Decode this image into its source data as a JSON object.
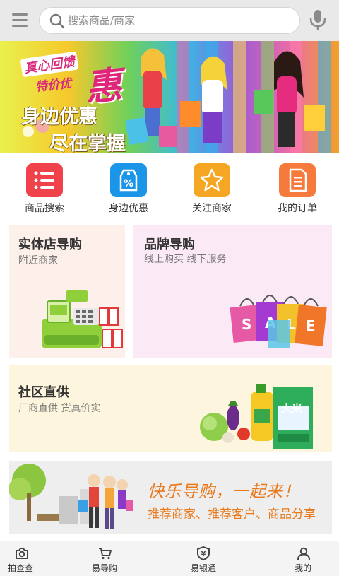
{
  "header": {
    "search_placeholder": "搜索商品/商家",
    "menu_icon": "menu-icon",
    "mic_icon": "microphone-icon"
  },
  "banner": {
    "slogan_line1": "真心回馈",
    "slogan_line2": "特价优",
    "slogan_big": "惠",
    "headline_1": "身边优惠",
    "headline_2": "尽在掌握"
  },
  "quick_actions": [
    {
      "label": "商品搜索",
      "icon": "list-icon",
      "color": "#f0424a"
    },
    {
      "label": "身边优惠",
      "icon": "discount-tag-icon",
      "color": "#1a95e8"
    },
    {
      "label": "关注商家",
      "icon": "star-icon",
      "color": "#f5a623"
    },
    {
      "label": "我的订单",
      "icon": "order-document-icon",
      "color": "#f57a3b"
    }
  ],
  "cards": {
    "store": {
      "title": "实体店导购",
      "subtitle": "附近商家",
      "bg": "#fdf0ea"
    },
    "brand": {
      "title": "品牌导购",
      "subtitle": "线上购买  线下服务",
      "bg": "#fbe9f5"
    },
    "community": {
      "title": "社区直供",
      "subtitle": "厂商直供  货真价实",
      "bg": "#fdf5dd"
    }
  },
  "promo": {
    "line1": "快乐导购，一起来！",
    "line2": "推荐商家、推荐客户、商品分享",
    "rice_label": "大米"
  },
  "bottom_nav": [
    {
      "label": "拍查查",
      "icon": "camera-icon"
    },
    {
      "label": "易导购",
      "icon": "cart-icon"
    },
    {
      "label": "易银通",
      "icon": "yuan-shield-icon"
    },
    {
      "label": "我的",
      "icon": "user-icon"
    }
  ]
}
